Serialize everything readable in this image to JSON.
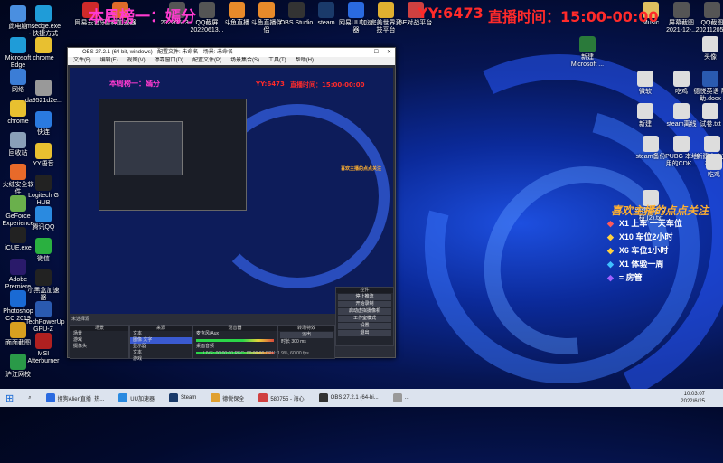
{
  "overlay": {
    "rank_text": "本周榜一：嫣分",
    "yy_id": "YY:6473",
    "broadcast_time": "直播时间：15:00-00:00",
    "follow_title": "喜欢主播的点点关注",
    "rewards": [
      "X1 上车 一天车位",
      "X10 车位2小时",
      "X6 车位1小时",
      "X1 体验一周",
      "= 房管"
    ]
  },
  "desktop_left": [
    {
      "label": "此电脑",
      "color": "#4a8fe0"
    },
    {
      "label": "Microsoft Edge",
      "color": "#1f9cd8"
    },
    {
      "label": "网络",
      "color": "#3b7dd6"
    },
    {
      "label": "chrome",
      "color": "#e8c030"
    },
    {
      "label": "回收站",
      "color": "#8aa0b8"
    },
    {
      "label": "火绒安全软件",
      "color": "#e86a2a"
    },
    {
      "label": "GeForce Experience",
      "color": "#6ab04c"
    },
    {
      "label": "iCUE.exe",
      "color": "#222"
    },
    {
      "label": "Adobe Premiere",
      "color": "#2a1a6a"
    },
    {
      "label": "Photoshop CC 2019",
      "color": "#1a6ad4"
    },
    {
      "label": "面面截图",
      "color": "#d8a020"
    },
    {
      "label": "沪江网校",
      "color": "#2a9a48"
    }
  ],
  "desktop_col2": [
    {
      "label": "msedge.exe - 快捷方式",
      "color": "#1f9cd8"
    },
    {
      "label": "chrome",
      "color": "#e8c030"
    },
    {
      "label": "da9521d2e...",
      "color": "#999"
    },
    {
      "label": "快连",
      "color": "#2a7ae0"
    },
    {
      "label": "YY语音",
      "color": "#e8c030"
    },
    {
      "label": "Logitech G HUB",
      "color": "#222"
    },
    {
      "label": "腾讯QQ",
      "color": "#2a8ae0"
    },
    {
      "label": "微信",
      "color": "#2ab040"
    },
    {
      "label": "小黑盒加速器",
      "color": "#222"
    },
    {
      "label": "TechPowerUp GPU-Z",
      "color": "#2a5ab0"
    },
    {
      "label": "MSI Afterburner",
      "color": "#b02020"
    }
  ],
  "desktop_top": [
    {
      "label": "网易云音乐",
      "color": "#d02a2a"
    },
    {
      "label": "雷神加速器",
      "color": "#e06a2a"
    },
    {
      "label": "20220613...",
      "color": "#555"
    },
    {
      "label": "QQ截屏 20220613...",
      "color": "#555"
    },
    {
      "label": "斗鱼直播",
      "color": "#e88a2a"
    },
    {
      "label": "斗鱼直播伴侣",
      "color": "#e88a2a"
    },
    {
      "label": "OBS Studio",
      "color": "#333"
    },
    {
      "label": "steam",
      "color": "#1a3a6a"
    },
    {
      "label": "网易UU加速器",
      "color": "#2a6ae0"
    },
    {
      "label": "完美世界竞技平台",
      "color": "#e0b030"
    },
    {
      "label": "5E对战平台",
      "color": "#d04040"
    }
  ],
  "desktop_right": [
    {
      "label": "Music",
      "color": "#e0c060"
    },
    {
      "label": "屏幕截图 2021-12-...",
      "color": "#555"
    },
    {
      "label": "QQ截图 20211205...",
      "color": "#555"
    },
    {
      "label": "新建 Microsoft ...",
      "color": "#2a7a3a"
    },
    {
      "label": "微软",
      "color": "#ddd"
    },
    {
      "label": "吃鸡",
      "color": "#ddd"
    },
    {
      "label": "德悦英语 帮助.docx",
      "color": "#2a5ab0"
    },
    {
      "label": "头像",
      "color": "#ddd"
    },
    {
      "label": "新建",
      "color": "#ddd"
    },
    {
      "label": "steam离线",
      "color": "#ddd"
    },
    {
      "label": "试卷.txt",
      "color": "#ddd"
    },
    {
      "label": "steam备份",
      "color": "#ddd"
    },
    {
      "label": "PUBG 本地 用的CDK...",
      "color": "#ddd"
    },
    {
      "label": "新建文本文档.txt",
      "color": "#ddd"
    },
    {
      "label": "吃鸡",
      "color": "#ddd"
    },
    {
      "label": "新建文本文档 (2).txt",
      "color": "#ddd"
    }
  ],
  "obs": {
    "title": "OBS 27.2.1 (64 bit, windows) - 配置文件: 未命名 - 场景: 未命名",
    "menu": [
      "文件(F)",
      "编辑(E)",
      "视图(V)",
      "停靠窗口(D)",
      "配置文件(P)",
      "场景集合(S)",
      "工具(T)",
      "帮助(H)"
    ],
    "no_source": "未选择源",
    "docks": {
      "scenes": {
        "title": "场景",
        "items": [
          "场景",
          "游戏",
          "摄像头"
        ]
      },
      "sources": {
        "title": "来源",
        "items": [
          "文本",
          "图像 文字",
          "显示器",
          "文本",
          "游戏"
        ]
      },
      "mixer": {
        "title": "混音器",
        "items": [
          "麦克风/Aux",
          "桌面音频"
        ],
        "levels": [
          "0.0 dB",
          "0.0 dB"
        ]
      },
      "transitions": {
        "title": "转场特效",
        "type": "淡出",
        "duration_label": "时长",
        "duration": "300 ms"
      },
      "controls": {
        "title": "控件",
        "buttons": [
          "停止推流",
          "开始录制",
          "启动虚拟摄像机",
          "工作室模式",
          "设置",
          "退出"
        ]
      }
    },
    "status": "LIVE: 00:00:00   REC: 00:00:00   CPU: 1.9%, 60.00 fps"
  },
  "taskbar": {
    "items": [
      "搜狗Alien直播_热...",
      "UU加速器",
      "Steam",
      "德悦保全",
      "580755 - 海心",
      "OBS 27.2.1 (64-bi...",
      "..."
    ],
    "time": "10:03:07",
    "date": "2022/6/25"
  }
}
